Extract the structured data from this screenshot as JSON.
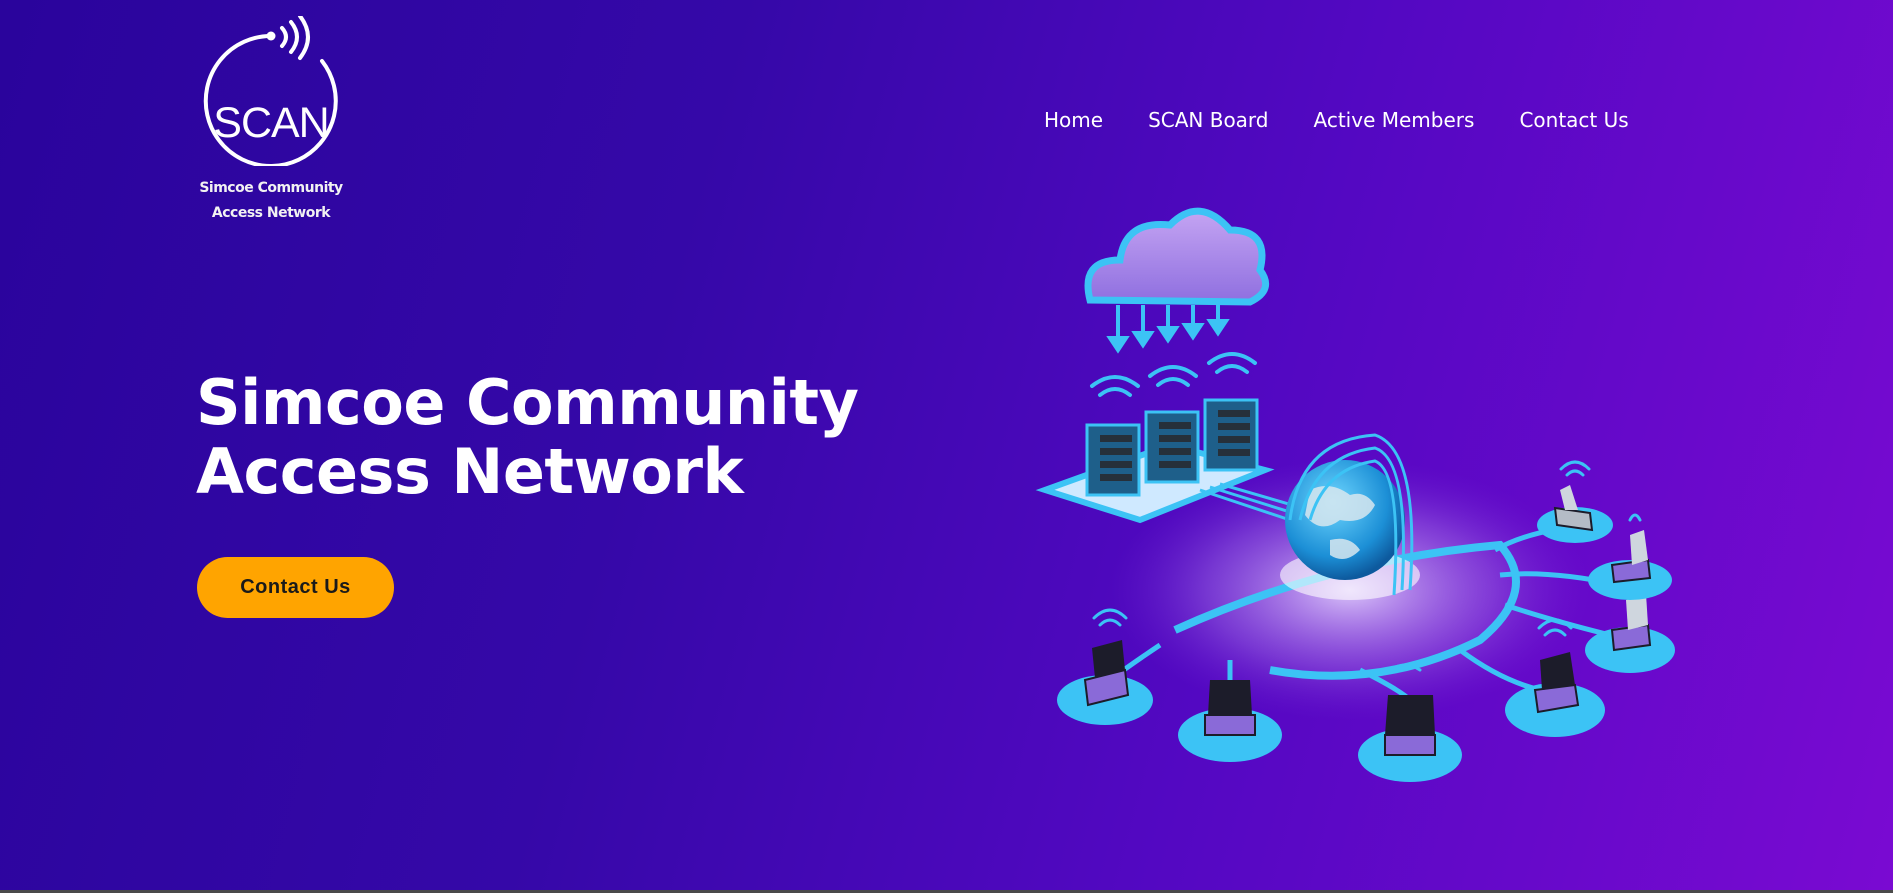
{
  "brand": {
    "logo_text": "SCAN",
    "caption_line1": "Simcoe Community",
    "caption_line2": "Access Network"
  },
  "nav": {
    "items": [
      {
        "label": "Home"
      },
      {
        "label": "SCAN Board"
      },
      {
        "label": "Active Members"
      },
      {
        "label": "Contact Us"
      }
    ]
  },
  "hero": {
    "title_line1": "Simcoe Community",
    "title_line2": "Access Network",
    "cta_label": "Contact Us"
  },
  "colors": {
    "cta": "#ffa400",
    "accent_cyan": "#3cc3f5"
  }
}
